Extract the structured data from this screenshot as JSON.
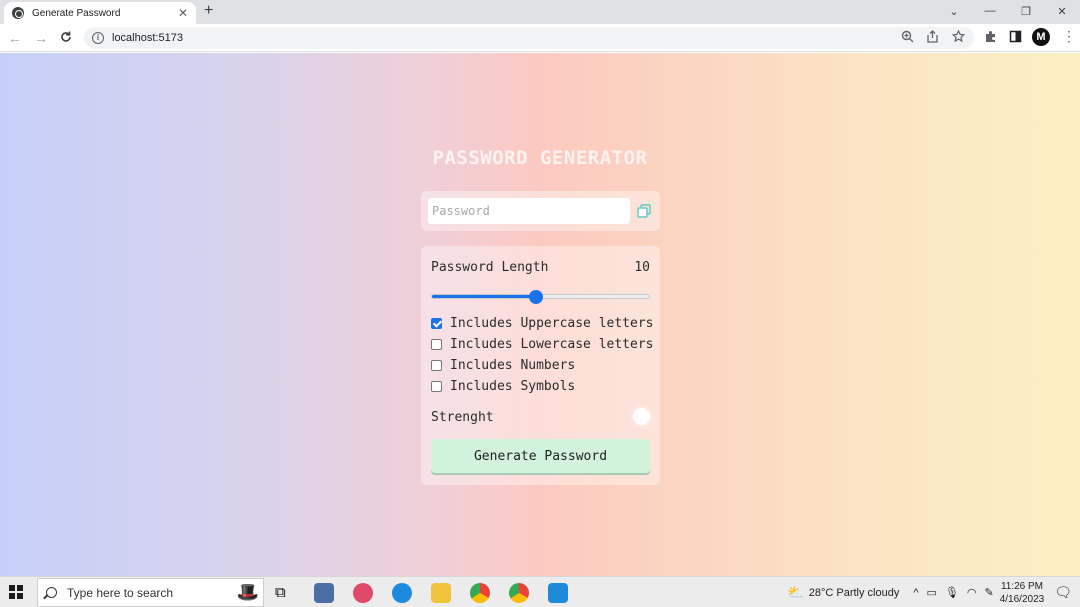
{
  "browser": {
    "tab_title": "Generate Password",
    "tab_close": "✕",
    "new_tab": "+",
    "url": "localhost:5173",
    "profile_initial": "M",
    "win_controls": [
      "⌄",
      "—",
      "❐",
      "✕"
    ]
  },
  "app": {
    "title": "PASSWORD GENERATOR",
    "password_placeholder": "Password",
    "password_value": "",
    "length_label": "Password Length",
    "length_value": "10",
    "length_fraction": 0.48,
    "options": [
      {
        "label": "Includes Uppercase letters",
        "checked": true
      },
      {
        "label": "Includes Lowercase letters",
        "checked": false
      },
      {
        "label": "Includes Numbers",
        "checked": false
      },
      {
        "label": "Includes Symbols",
        "checked": false
      }
    ],
    "strength_label": "Strenght",
    "generate_label": "Generate Password"
  },
  "taskbar": {
    "search_placeholder": "Type here to search",
    "weather": "28°C  Partly cloudy",
    "time": "11:26 PM",
    "date": "4/16/2023"
  },
  "colors": {
    "accent": "#1a73e8",
    "button_bg": "#d2f2dc",
    "copy_icon": "#5fc9c4"
  }
}
